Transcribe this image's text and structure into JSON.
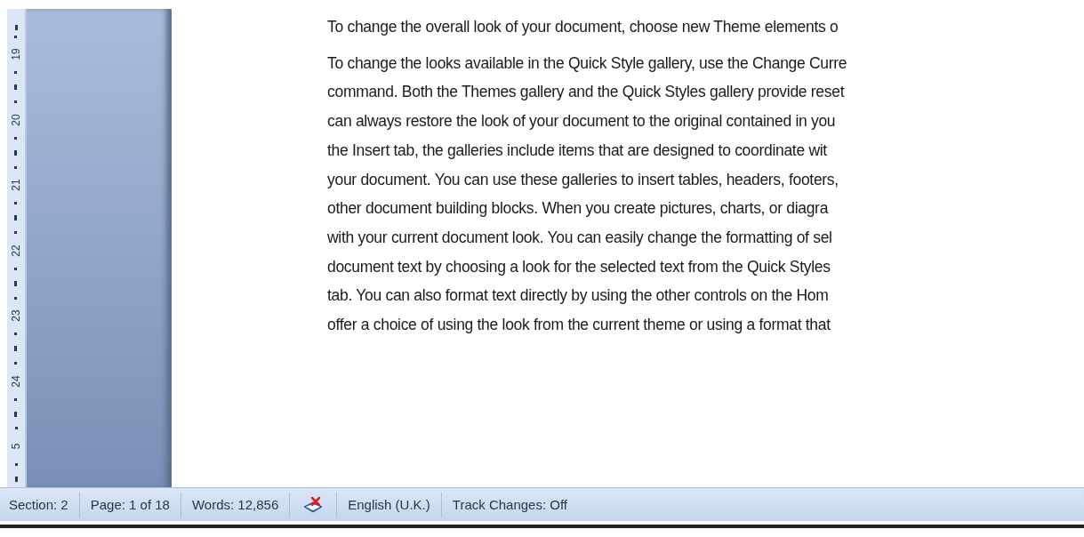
{
  "ruler": {
    "numbers": [
      "19",
      "20",
      "21",
      "22",
      "23",
      "24",
      "5"
    ]
  },
  "document": {
    "paragraphs": [
      [
        "To change the overall look of your document, choose new Theme elements o"
      ],
      [
        "To change the looks available in the Quick Style gallery, use the Change Curre",
        "command. Both the Themes gallery and the Quick Styles gallery provide reset",
        "can always restore the look of your document to the original contained in you",
        "the Insert tab, the galleries include items that are designed to coordinate wit",
        "your document. You can use these galleries to insert tables, headers, footers,",
        "other document building blocks. When you create pictures, charts, or diagra",
        "with your current document look. You can easily change the formatting of sel",
        "document text by choosing a look for the selected text from the Quick Styles",
        "tab. You can also format text directly by using the other controls on the Hom",
        "offer a choice of using the look from the current theme or using a format that"
      ]
    ]
  },
  "status_bar": {
    "items": [
      {
        "kind": "text",
        "label": "Section: 2"
      },
      {
        "kind": "text",
        "label": "Page: 1 of 18"
      },
      {
        "kind": "text",
        "label": "Words: 12,856"
      },
      {
        "kind": "proofing_icon"
      },
      {
        "kind": "text",
        "label": "English (U.K.)"
      },
      {
        "kind": "text",
        "label": "Track Changes: Off"
      }
    ]
  }
}
